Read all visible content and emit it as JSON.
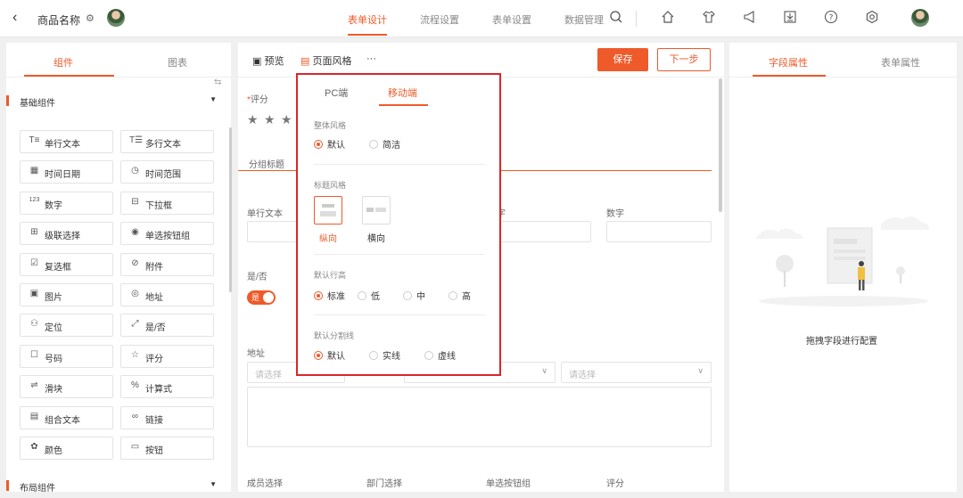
{
  "topbar": {
    "back_glyph": "‹",
    "app_name": "商品名称",
    "tabs": [
      "表单设计",
      "流程设置",
      "表单设置",
      "数据管理"
    ],
    "icons": [
      "search-icon",
      "home-icon",
      "shirt-icon",
      "megaphone-icon",
      "download-icon",
      "help-icon",
      "settings-icon"
    ]
  },
  "left_panel": {
    "tabs": [
      "组件",
      "图表"
    ],
    "section_basic": "基础组件",
    "section_layout": "布局组件",
    "components": [
      {
        "icon": "T≡",
        "label": "单行文本"
      },
      {
        "icon": "T☰",
        "label": "多行文本"
      },
      {
        "icon": "▦",
        "label": "时间日期"
      },
      {
        "icon": "◷",
        "label": "时间范围"
      },
      {
        "icon": "123",
        "label": "数字"
      },
      {
        "icon": "⊟",
        "label": "下拉框"
      },
      {
        "icon": "⊞",
        "label": "级联选择"
      },
      {
        "icon": "◉",
        "label": "单选按钮组"
      },
      {
        "icon": "☑",
        "label": "复选框"
      },
      {
        "icon": "⊘",
        "label": "附件"
      },
      {
        "icon": "▣",
        "label": "图片"
      },
      {
        "icon": "◎",
        "label": "地址"
      },
      {
        "icon": "⚇",
        "label": "定位"
      },
      {
        "icon": "⤢",
        "label": "是/否"
      },
      {
        "icon": "☐",
        "label": "号码"
      },
      {
        "icon": "☆",
        "label": "评分"
      },
      {
        "icon": "⇌",
        "label": "滑块"
      },
      {
        "icon": "%",
        "label": "计算式"
      },
      {
        "icon": "▤",
        "label": "组合文本"
      },
      {
        "icon": "∞",
        "label": "链接"
      },
      {
        "icon": "✿",
        "label": "颜色"
      },
      {
        "icon": "▭",
        "label": "按钮"
      }
    ]
  },
  "canvas": {
    "toolbar": {
      "preview": "预览",
      "page_style": "页面风格",
      "more": "···",
      "save": "保存",
      "next": "下一步"
    },
    "rating_label": "评分",
    "required_mark": "*",
    "group_title": "分组标题",
    "field_labels": [
      "单行文本",
      "字",
      "数字"
    ],
    "yesno_label": "是/否",
    "toggle_text": "是",
    "address_label": "地址",
    "select_placeholder": "请选择",
    "bottom_labels": [
      "成员选择",
      "部门选择",
      "单选按钮组",
      "评分"
    ]
  },
  "right_panel": {
    "tabs": [
      "字段属性",
      "表单属性"
    ],
    "empty_text": "拖拽字段进行配置"
  },
  "style_popup": {
    "tabs": [
      "PC端",
      "移动端"
    ],
    "active_tab": "移动端",
    "overall_style": {
      "label": "整体风格",
      "options": [
        "默认",
        "简洁"
      ],
      "selected": "默认"
    },
    "title_style": {
      "label": "标题风格",
      "options": [
        "纵向",
        "横向"
      ],
      "selected": "纵向"
    },
    "row_height": {
      "label": "默认行高",
      "options": [
        "标准",
        "低",
        "中",
        "高"
      ],
      "selected": "标准"
    },
    "divider": {
      "label": "默认分割线",
      "options": [
        "默认",
        "实线",
        "虚线"
      ],
      "selected": "默认"
    }
  },
  "colors": {
    "accent": "#ef5a2a",
    "highlight_border": "#d9262b"
  }
}
